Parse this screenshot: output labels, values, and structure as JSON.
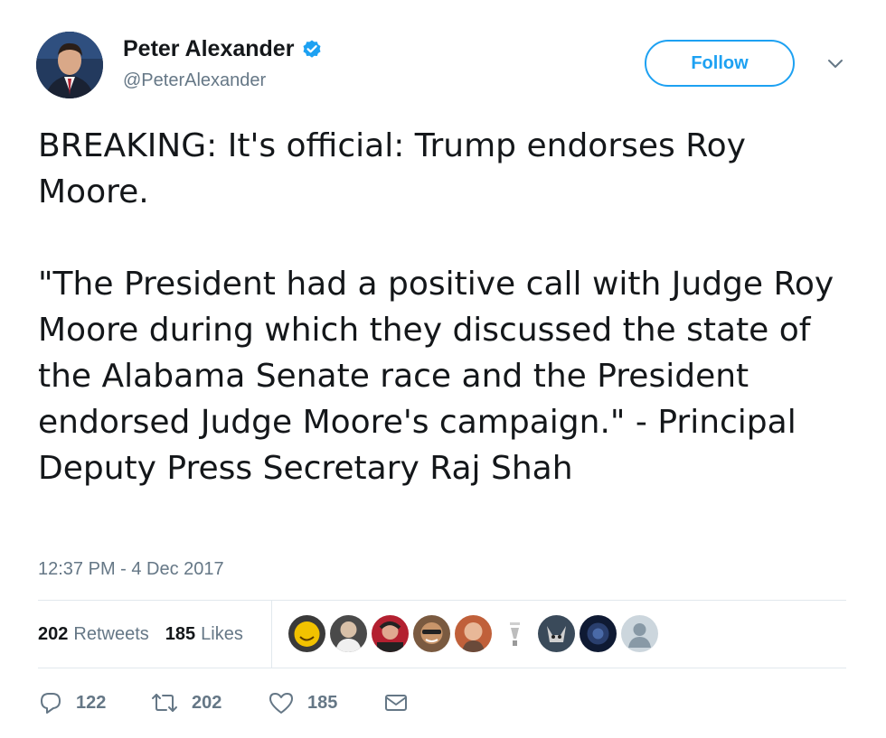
{
  "author": {
    "display_name": "Peter Alexander",
    "handle": "@PeterAlexander",
    "verified": true,
    "avatar_icon": "profile-photo"
  },
  "follow_button": {
    "label": "Follow",
    "color": "#1da1f2"
  },
  "tweet": {
    "text": "BREAKING: It's official: Trump endorses Roy Moore.\n\n\"The President had a positive call with Judge Roy Moore during which they discussed the state of the Alabama Senate race and the President endorsed Judge Moore's campaign.\" - Principal Deputy Press Secretary Raj Shah",
    "timestamp": "12:37 PM - 4 Dec 2017"
  },
  "stats": {
    "retweets": {
      "count": "202",
      "label": "Retweets"
    },
    "likes": {
      "count": "185",
      "label": "Likes"
    }
  },
  "likers": [
    {
      "icon": "liker-avatar",
      "color": "#f2c200"
    },
    {
      "icon": "liker-avatar",
      "color": "#7a6a5a"
    },
    {
      "icon": "liker-avatar",
      "color": "#b32030"
    },
    {
      "icon": "liker-avatar",
      "color": "#8a5a3a"
    },
    {
      "icon": "liker-avatar",
      "color": "#c0603a"
    },
    {
      "icon": "liker-avatar",
      "color": "#cfcfcf"
    },
    {
      "icon": "liker-avatar",
      "color": "#3a4a5a"
    },
    {
      "icon": "liker-avatar",
      "color": "#2a3f6e"
    },
    {
      "icon": "default-avatar",
      "color": "#ccd6dd"
    }
  ],
  "actions": {
    "reply": {
      "icon": "reply-icon",
      "count": "122"
    },
    "retweet": {
      "icon": "retweet-icon",
      "count": "202"
    },
    "like": {
      "icon": "heart-icon",
      "count": "185"
    },
    "message": {
      "icon": "envelope-icon"
    }
  },
  "colors": {
    "secondary_text": "#657786",
    "primary_text": "#14171a",
    "divider": "#e1e8ed",
    "verified_badge": "#1da1f2"
  }
}
